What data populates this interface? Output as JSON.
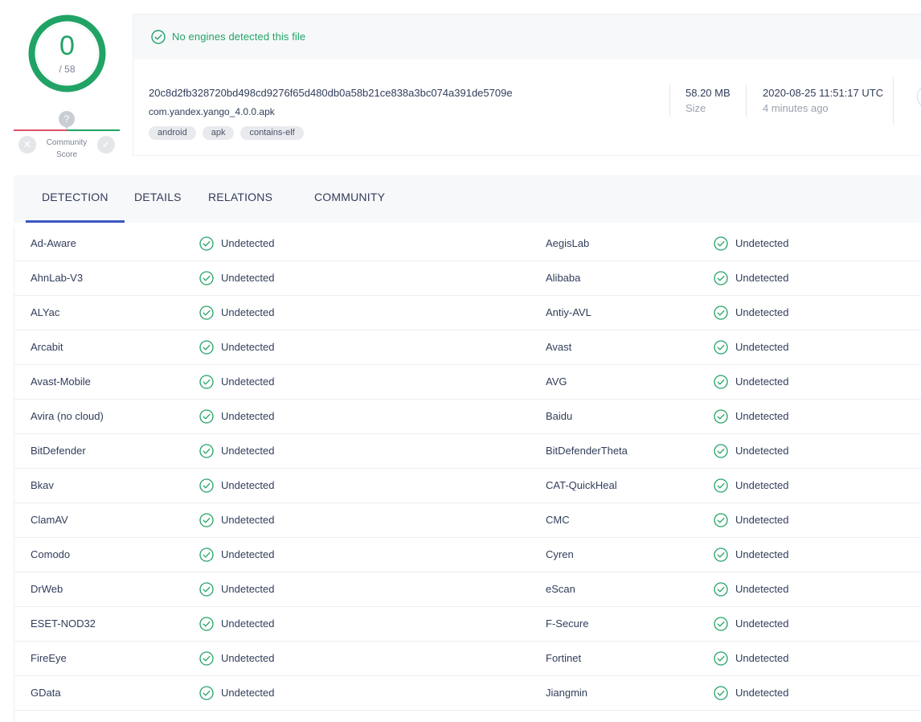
{
  "score": {
    "detected": "0",
    "total": "/ 58"
  },
  "community": {
    "label_line1": "Community",
    "label_line2": "Score",
    "question": "?"
  },
  "banner": {
    "message": "No engines detected this file"
  },
  "file": {
    "hash": "20c8d2fb328720bd498cd9276f65d480db0a58b21ce838a3bc074a391de5709e",
    "name": "com.yandex.yango_4.0.0.apk",
    "tags": [
      "android",
      "apk",
      "contains-elf"
    ],
    "size": "58.20 MB",
    "size_label": "Size",
    "date": "2020-08-25 11:51:17 UTC",
    "date_label": "4 minutes ago"
  },
  "tabs": [
    {
      "label": "DETECTION",
      "active": true
    },
    {
      "label": "DETAILS",
      "active": false
    },
    {
      "label": "RELATIONS",
      "active": false
    },
    {
      "label": "COMMUNITY",
      "active": false
    }
  ],
  "colors": {
    "clean": "#21a366",
    "accent": "#3b56c4",
    "malicious": "#e0506a"
  },
  "detections": [
    {
      "left": {
        "engine": "Ad-Aware",
        "result": "Undetected"
      },
      "right": {
        "engine": "AegisLab",
        "result": "Undetected"
      }
    },
    {
      "left": {
        "engine": "AhnLab-V3",
        "result": "Undetected"
      },
      "right": {
        "engine": "Alibaba",
        "result": "Undetected"
      }
    },
    {
      "left": {
        "engine": "ALYac",
        "result": "Undetected"
      },
      "right": {
        "engine": "Antiy-AVL",
        "result": "Undetected"
      }
    },
    {
      "left": {
        "engine": "Arcabit",
        "result": "Undetected"
      },
      "right": {
        "engine": "Avast",
        "result": "Undetected"
      }
    },
    {
      "left": {
        "engine": "Avast-Mobile",
        "result": "Undetected"
      },
      "right": {
        "engine": "AVG",
        "result": "Undetected"
      }
    },
    {
      "left": {
        "engine": "Avira (no cloud)",
        "result": "Undetected"
      },
      "right": {
        "engine": "Baidu",
        "result": "Undetected"
      }
    },
    {
      "left": {
        "engine": "BitDefender",
        "result": "Undetected"
      },
      "right": {
        "engine": "BitDefenderTheta",
        "result": "Undetected"
      }
    },
    {
      "left": {
        "engine": "Bkav",
        "result": "Undetected"
      },
      "right": {
        "engine": "CAT-QuickHeal",
        "result": "Undetected"
      }
    },
    {
      "left": {
        "engine": "ClamAV",
        "result": "Undetected"
      },
      "right": {
        "engine": "CMC",
        "result": "Undetected"
      }
    },
    {
      "left": {
        "engine": "Comodo",
        "result": "Undetected"
      },
      "right": {
        "engine": "Cyren",
        "result": "Undetected"
      }
    },
    {
      "left": {
        "engine": "DrWeb",
        "result": "Undetected"
      },
      "right": {
        "engine": "eScan",
        "result": "Undetected"
      }
    },
    {
      "left": {
        "engine": "ESET-NOD32",
        "result": "Undetected"
      },
      "right": {
        "engine": "F-Secure",
        "result": "Undetected"
      }
    },
    {
      "left": {
        "engine": "FireEye",
        "result": "Undetected"
      },
      "right": {
        "engine": "Fortinet",
        "result": "Undetected"
      }
    },
    {
      "left": {
        "engine": "GData",
        "result": "Undetected"
      },
      "right": {
        "engine": "Jiangmin",
        "result": "Undetected"
      }
    }
  ]
}
